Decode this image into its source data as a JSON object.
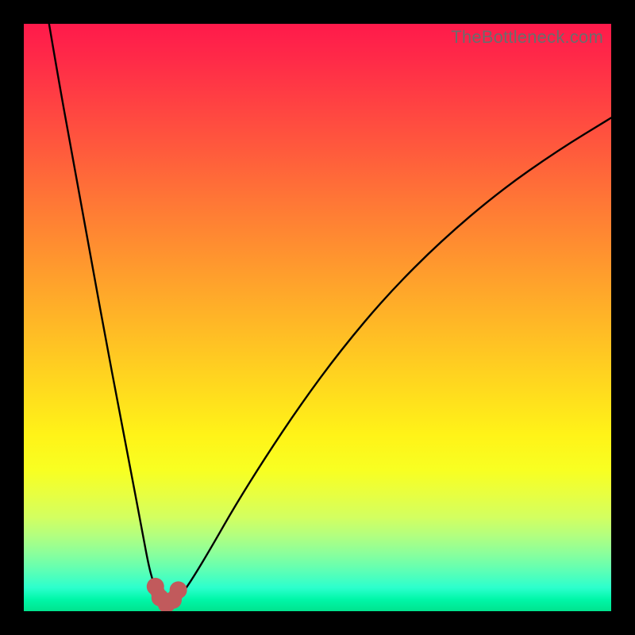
{
  "watermark": "TheBottleneck.com",
  "colors": {
    "frame": "#000000",
    "curve": "#000000",
    "marker": "#c15a5c"
  },
  "chart_data": {
    "type": "line",
    "title": "",
    "xlabel": "",
    "ylabel": "",
    "xlim": [
      0,
      100
    ],
    "ylim": [
      0,
      100
    ],
    "grid": false,
    "legend": false,
    "note": "Bottleneck-style V curve. X is normalized horizontal position (0–100 across plot width). Y is bottleneck severity percent (0 = green bottom, 100 = red top). Values estimated from pixel positions.",
    "series": [
      {
        "name": "left-branch",
        "x": [
          4.3,
          6,
          8,
          10,
          12,
          14,
          16,
          18,
          20,
          21.2,
          22,
          23,
          24,
          24.5
        ],
        "y": [
          100,
          90,
          79,
          68,
          57,
          46,
          35.5,
          25,
          14.5,
          8,
          5,
          2.5,
          1.5,
          1.2
        ]
      },
      {
        "name": "right-branch",
        "x": [
          24.5,
          25.5,
          27,
          29,
          32,
          36,
          41,
          47,
          54,
          62,
          71,
          81,
          91,
          100
        ],
        "y": [
          1.2,
          1.6,
          3,
          6,
          11,
          18,
          26,
          35,
          44.5,
          54,
          63,
          71.5,
          78.5,
          84
        ]
      },
      {
        "name": "sweet-spot-markers",
        "x": [
          22.4,
          23.2,
          24.3,
          25.4,
          26.3
        ],
        "y": [
          4.2,
          2.3,
          1.2,
          1.9,
          3.6
        ]
      }
    ]
  }
}
